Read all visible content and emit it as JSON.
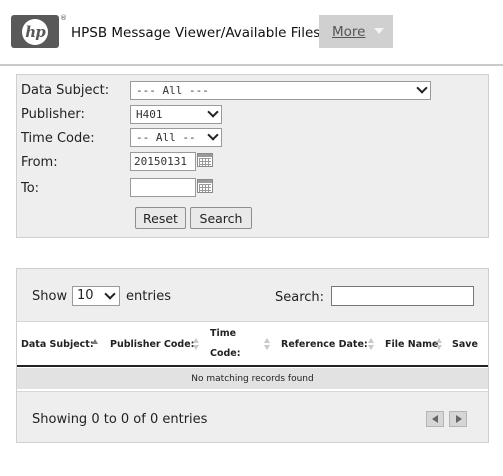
{
  "header": {
    "logo_text": "hp",
    "registered_mark": "®",
    "title": "HPSB Message Viewer/Available Files",
    "more_label": "More"
  },
  "filters": {
    "data_subject": {
      "label": "Data Subject:",
      "value": "--- All ---"
    },
    "publisher": {
      "label": "Publisher:",
      "value": "H401"
    },
    "time_code": {
      "label": "Time Code:",
      "value": "-- All --"
    },
    "from": {
      "label": "From:",
      "value": "20150131"
    },
    "to": {
      "label": "To:",
      "value": ""
    },
    "reset_label": "Reset",
    "search_label": "Search"
  },
  "results": {
    "show_label": "Show",
    "page_length": "10",
    "entries_label": "entries",
    "search_label": "Search:",
    "search_value": "",
    "columns": [
      {
        "line1": "Data Subject:",
        "line2": ""
      },
      {
        "line1": "Publisher Code:",
        "line2": ""
      },
      {
        "line1": "Time",
        "line2": "Code:"
      },
      {
        "line1": "Reference Date:",
        "line2": ""
      },
      {
        "line1": "File Name",
        "line2": ""
      },
      {
        "line1": "Save",
        "line2": ""
      }
    ],
    "empty_message": "No matching records found",
    "info": "Showing 0 to 0 of 0 entries"
  }
}
